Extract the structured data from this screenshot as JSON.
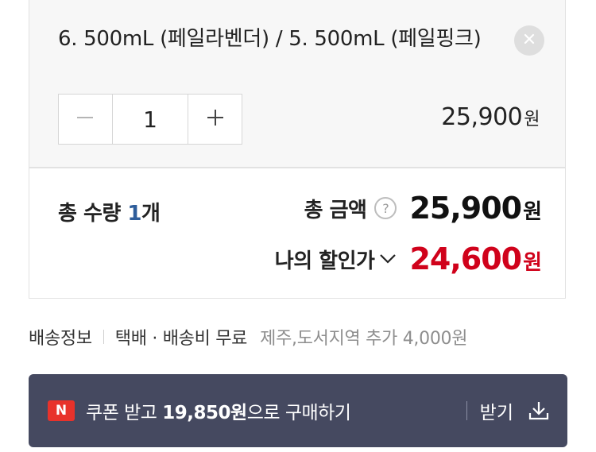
{
  "option": {
    "title": "6. 500mL (페일라벤더) / 5. 500mL (페일핑크)",
    "quantity": "1",
    "price_number": "25,900",
    "price_unit": "원"
  },
  "summary": {
    "qty_label": "총 수량 ",
    "qty_value": "1",
    "qty_unit": "개",
    "total_label": "총 금액",
    "help_glyph": "?",
    "total_number": "25,900",
    "total_unit": "원",
    "discount_label": "나의 할인가",
    "discount_number": "24,600",
    "discount_unit": "원"
  },
  "shipping": {
    "label": "배송정보",
    "method": "택배 · 배송비 무료",
    "note": "제주,도서지역 추가 4,000원"
  },
  "coupon": {
    "badge": "N",
    "prefix": "쿠폰 받고 ",
    "amount": "19,850원",
    "suffix": "으로 구매하기",
    "receive_label": "받기"
  },
  "colors": {
    "accent_red": "#d0021b",
    "qty_blue": "#2e5d9b",
    "coupon_bar": "#454960",
    "naver_badge": "#e8322b"
  },
  "icons": {
    "remove": "close-icon",
    "minus": "minus-icon",
    "plus": "plus-icon",
    "help": "question-icon",
    "discount_toggle": "chevron-down-icon",
    "download": "download-icon"
  }
}
